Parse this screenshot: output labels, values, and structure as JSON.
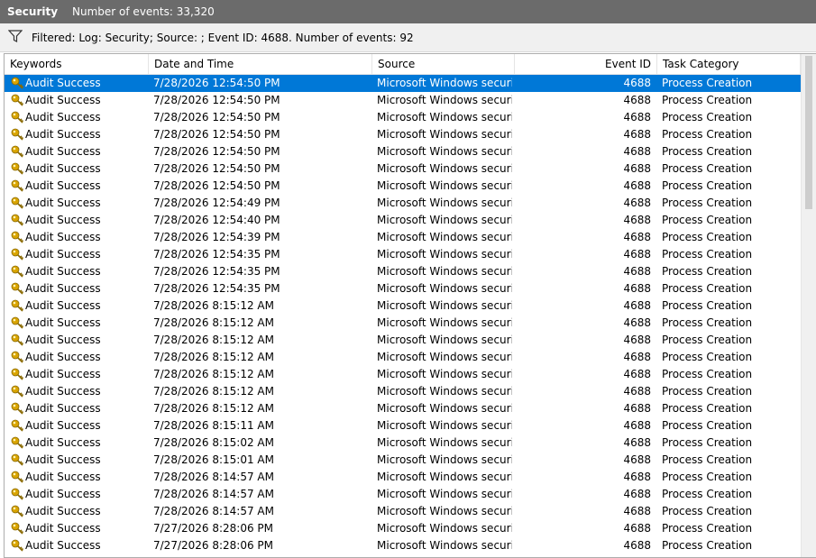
{
  "title": "Security",
  "event_count": "Number of events: 33,320",
  "filter": {
    "icon": "filter-icon",
    "text": "Filtered: Log: Security; Source: ; Event ID: 4688. Number of events: 92"
  },
  "columns": {
    "keywords": "Keywords",
    "date_time": "Date and Time",
    "source": "Source",
    "event_id": "Event ID",
    "task_category": "Task Category"
  },
  "colors": {
    "selection": "#0078d7",
    "titlebar": "#6b6b6b",
    "key_icon": "#d9a400"
  },
  "rows": [
    {
      "keywords": "Audit Success",
      "date": "7/28/2026 12:54:50 PM",
      "source": "Microsoft Windows securi...",
      "event_id": "4688",
      "task": "Process Creation",
      "selected": true
    },
    {
      "keywords": "Audit Success",
      "date": "7/28/2026 12:54:50 PM",
      "source": "Microsoft Windows securi...",
      "event_id": "4688",
      "task": "Process Creation"
    },
    {
      "keywords": "Audit Success",
      "date": "7/28/2026 12:54:50 PM",
      "source": "Microsoft Windows securi...",
      "event_id": "4688",
      "task": "Process Creation"
    },
    {
      "keywords": "Audit Success",
      "date": "7/28/2026 12:54:50 PM",
      "source": "Microsoft Windows securi...",
      "event_id": "4688",
      "task": "Process Creation"
    },
    {
      "keywords": "Audit Success",
      "date": "7/28/2026 12:54:50 PM",
      "source": "Microsoft Windows securi...",
      "event_id": "4688",
      "task": "Process Creation"
    },
    {
      "keywords": "Audit Success",
      "date": "7/28/2026 12:54:50 PM",
      "source": "Microsoft Windows securi...",
      "event_id": "4688",
      "task": "Process Creation"
    },
    {
      "keywords": "Audit Success",
      "date": "7/28/2026 12:54:50 PM",
      "source": "Microsoft Windows securi...",
      "event_id": "4688",
      "task": "Process Creation"
    },
    {
      "keywords": "Audit Success",
      "date": "7/28/2026 12:54:49 PM",
      "source": "Microsoft Windows securi...",
      "event_id": "4688",
      "task": "Process Creation"
    },
    {
      "keywords": "Audit Success",
      "date": "7/28/2026 12:54:40 PM",
      "source": "Microsoft Windows securi...",
      "event_id": "4688",
      "task": "Process Creation"
    },
    {
      "keywords": "Audit Success",
      "date": "7/28/2026 12:54:39 PM",
      "source": "Microsoft Windows securi...",
      "event_id": "4688",
      "task": "Process Creation"
    },
    {
      "keywords": "Audit Success",
      "date": "7/28/2026 12:54:35 PM",
      "source": "Microsoft Windows securi...",
      "event_id": "4688",
      "task": "Process Creation"
    },
    {
      "keywords": "Audit Success",
      "date": "7/28/2026 12:54:35 PM",
      "source": "Microsoft Windows securi...",
      "event_id": "4688",
      "task": "Process Creation"
    },
    {
      "keywords": "Audit Success",
      "date": "7/28/2026 12:54:35 PM",
      "source": "Microsoft Windows securi...",
      "event_id": "4688",
      "task": "Process Creation"
    },
    {
      "keywords": "Audit Success",
      "date": "7/28/2026 8:15:12 AM",
      "source": "Microsoft Windows securi...",
      "event_id": "4688",
      "task": "Process Creation"
    },
    {
      "keywords": "Audit Success",
      "date": "7/28/2026 8:15:12 AM",
      "source": "Microsoft Windows securi...",
      "event_id": "4688",
      "task": "Process Creation"
    },
    {
      "keywords": "Audit Success",
      "date": "7/28/2026 8:15:12 AM",
      "source": "Microsoft Windows securi...",
      "event_id": "4688",
      "task": "Process Creation"
    },
    {
      "keywords": "Audit Success",
      "date": "7/28/2026 8:15:12 AM",
      "source": "Microsoft Windows securi...",
      "event_id": "4688",
      "task": "Process Creation"
    },
    {
      "keywords": "Audit Success",
      "date": "7/28/2026 8:15:12 AM",
      "source": "Microsoft Windows securi...",
      "event_id": "4688",
      "task": "Process Creation"
    },
    {
      "keywords": "Audit Success",
      "date": "7/28/2026 8:15:12 AM",
      "source": "Microsoft Windows securi...",
      "event_id": "4688",
      "task": "Process Creation"
    },
    {
      "keywords": "Audit Success",
      "date": "7/28/2026 8:15:12 AM",
      "source": "Microsoft Windows securi...",
      "event_id": "4688",
      "task": "Process Creation"
    },
    {
      "keywords": "Audit Success",
      "date": "7/28/2026 8:15:11 AM",
      "source": "Microsoft Windows securi...",
      "event_id": "4688",
      "task": "Process Creation"
    },
    {
      "keywords": "Audit Success",
      "date": "7/28/2026 8:15:02 AM",
      "source": "Microsoft Windows securi...",
      "event_id": "4688",
      "task": "Process Creation"
    },
    {
      "keywords": "Audit Success",
      "date": "7/28/2026 8:15:01 AM",
      "source": "Microsoft Windows securi...",
      "event_id": "4688",
      "task": "Process Creation"
    },
    {
      "keywords": "Audit Success",
      "date": "7/28/2026 8:14:57 AM",
      "source": "Microsoft Windows securi...",
      "event_id": "4688",
      "task": "Process Creation"
    },
    {
      "keywords": "Audit Success",
      "date": "7/28/2026 8:14:57 AM",
      "source": "Microsoft Windows securi...",
      "event_id": "4688",
      "task": "Process Creation"
    },
    {
      "keywords": "Audit Success",
      "date": "7/28/2026 8:14:57 AM",
      "source": "Microsoft Windows securi...",
      "event_id": "4688",
      "task": "Process Creation"
    },
    {
      "keywords": "Audit Success",
      "date": "7/27/2026 8:28:06 PM",
      "source": "Microsoft Windows securi...",
      "event_id": "4688",
      "task": "Process Creation"
    },
    {
      "keywords": "Audit Success",
      "date": "7/27/2026 8:28:06 PM",
      "source": "Microsoft Windows securi...",
      "event_id": "4688",
      "task": "Process Creation"
    }
  ]
}
